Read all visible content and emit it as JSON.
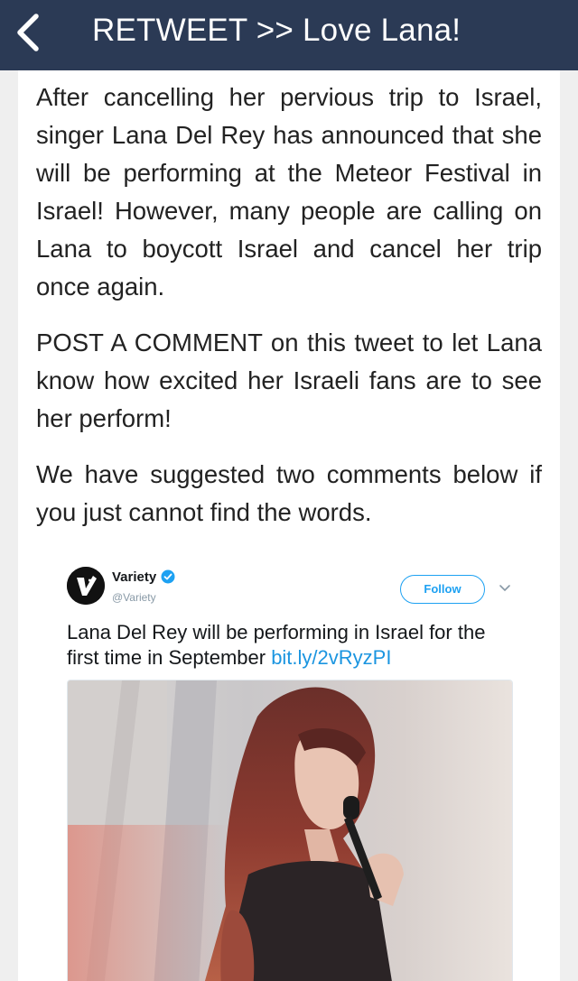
{
  "header": {
    "back_icon": "chevron-left-icon",
    "title": "RETWEET >> Love Lana!"
  },
  "article": {
    "paragraphs": [
      "After cancelling her pervious trip to Israel, singer Lana Del Rey has announced that she will be performing at the Meteor Festival in Israel! However, many people are calling on Lana to boycott Israel and cancel her trip once again.",
      "POST A COMMENT on this tweet to let Lana know how excited her Israeli fans are to see her perform!",
      "We have suggested two comments below if you just cannot find the words."
    ]
  },
  "tweet": {
    "author_name": "Variety",
    "author_handle": "@Variety",
    "follow_label": "Follow",
    "text": "Lana Del Rey will be performing in Israel for the first time in September ",
    "link": "bit.ly/2vRyzPI",
    "verified_icon": "verified-badge-icon",
    "menu_icon": "chevron-down-icon",
    "photo": "singer-with-microphone-photo"
  },
  "colors": {
    "header_bg": "#2b3a55",
    "page_bg": "#efefef",
    "link": "#1b95e0",
    "follow": "#1da1f2"
  }
}
